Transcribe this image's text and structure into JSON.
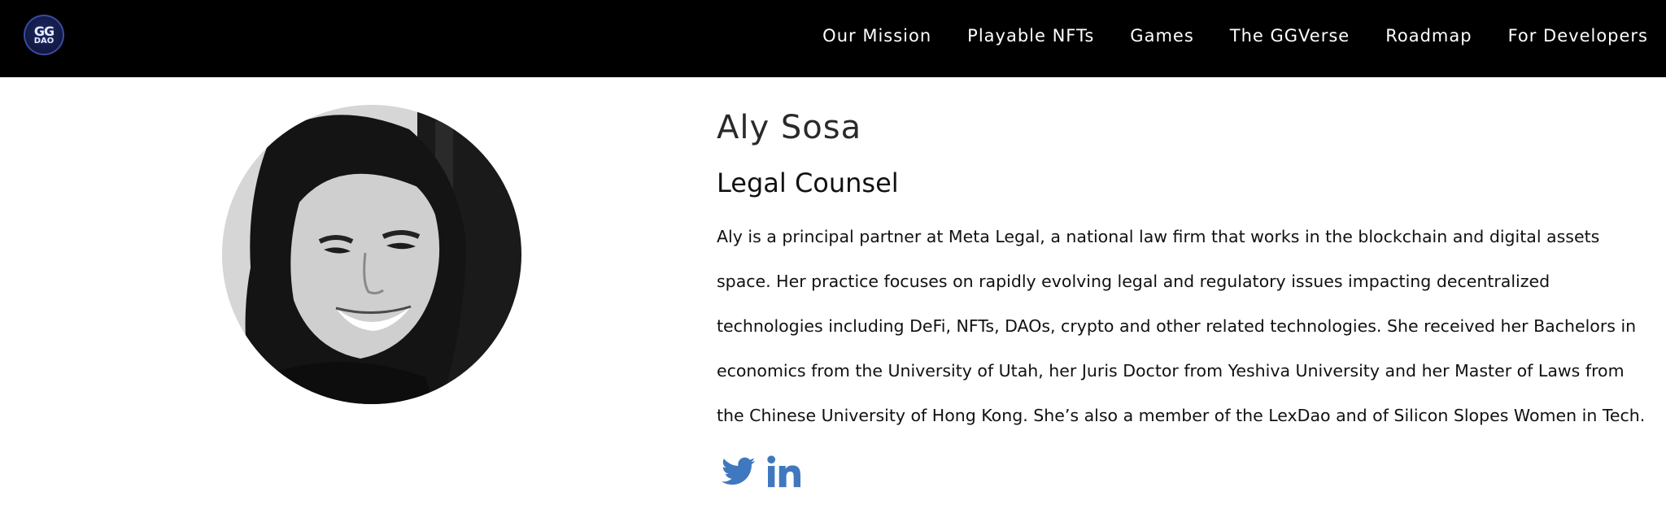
{
  "header": {
    "logo_text_top": "GG",
    "logo_text_bottom": "DAO",
    "nav": [
      {
        "label": "Our Mission"
      },
      {
        "label": "Playable NFTs"
      },
      {
        "label": "Games"
      },
      {
        "label": "The GGVerse"
      },
      {
        "label": "Roadmap"
      },
      {
        "label": "For Developers"
      }
    ]
  },
  "profile": {
    "name": "Aly Sosa",
    "role": "Legal Counsel",
    "bio": "Aly is a principal partner at Meta Legal, a national law firm that works in the blockchain and digital assets space. Her practice focuses on rapidly evolving legal and regulatory issues impacting decentralized technologies including DeFi, NFTs, DAOs, crypto and other related technologies. She received her Bachelors in economics from the University of Utah, her Juris Doctor from Yeshiva University and her Master of Laws from the Chinese University of Hong Kong. She’s also a member of the LexDao and of Silicon Slopes Women in Tech.",
    "social": [
      {
        "icon": "twitter-icon"
      },
      {
        "icon": "linkedin-icon"
      }
    ]
  },
  "colors": {
    "header_bg": "#000000",
    "nav_text": "#ffffff",
    "social_icon": "#3f78bf",
    "text": "#111111"
  }
}
